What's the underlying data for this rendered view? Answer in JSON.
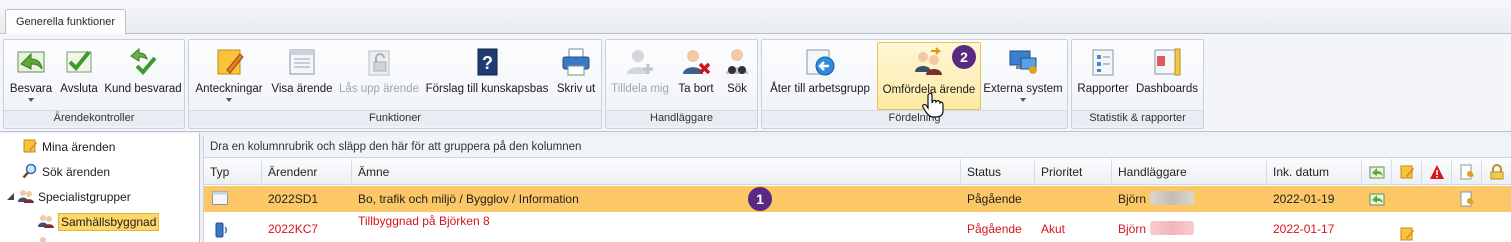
{
  "tab": {
    "label": "Generella funktioner"
  },
  "ribbon": {
    "groups": {
      "arendekontroller": "Ärendekontroller",
      "funktioner": "Funktioner",
      "handlaggare": "Handläggare",
      "fordelning": "Fördelning",
      "statistik": "Statistik & rapporter"
    },
    "buttons": {
      "besvara": "Besvara",
      "avsluta": "Avsluta",
      "kund_besvarad": "Kund besvarad",
      "anteckningar": "Anteckningar",
      "visa_arende": "Visa ärende",
      "las_upp_arende": "Lås upp ärende",
      "forslag": "Förslag till kunskapsbas",
      "skriv_ut": "Skriv ut",
      "tilldela_mig": "Tilldela mig",
      "ta_bort": "Ta bort",
      "sok": "Sök",
      "ater_till": "Åter till arbetsgrupp",
      "omfordela": "Omfördela ärende",
      "externa_system": "Externa system",
      "rapporter": "Rapporter",
      "dashboards": "Dashboards"
    },
    "badge": "2"
  },
  "tree": {
    "items": [
      {
        "label": "Mina ärenden",
        "icon": "notes-icon"
      },
      {
        "label": "Sök ärenden",
        "icon": "search-icon"
      },
      {
        "label": "Specialistgrupper",
        "icon": "group-icon"
      },
      {
        "label": "Samhällsbyggnad",
        "icon": "group-icon"
      }
    ]
  },
  "grid": {
    "group_hint": "Dra en kolumnrubrik och släpp den här för att gruppera på den kolumnen",
    "columns": [
      "Typ",
      "Ärendenr",
      "Ämne",
      "Status",
      "Prioritet",
      "Handläggare",
      "Ink. datum"
    ],
    "rows": [
      {
        "arendenr": "2022SD1",
        "amne": "Bo, trafik och miljö / Bygglov / Information",
        "status": "Pågående",
        "prioritet": "",
        "handlaggare": "Björn",
        "datum": "2022-01-19",
        "badge": "1"
      },
      {
        "arendenr": "2022KC7",
        "amne": "Tillbyggnad på Björken 8",
        "status": "Pågående",
        "prioritet": "Akut",
        "handlaggare": "Björn",
        "datum": "2022-01-17"
      }
    ]
  },
  "colors": {
    "selection": "#fcc867",
    "urgent": "#d8141c",
    "badge": "#5a2a82"
  }
}
